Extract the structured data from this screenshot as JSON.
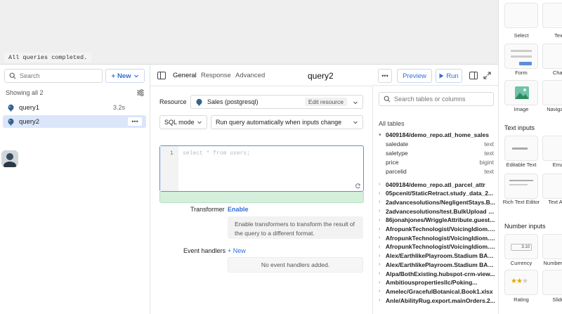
{
  "canvas": {
    "status": "All queries completed."
  },
  "query_list": {
    "search_placeholder": "Search",
    "new_label": "New",
    "showing": "Showing all 2",
    "queries": [
      {
        "name": "query1",
        "time": "3.2s"
      },
      {
        "name": "query2",
        "time": ""
      }
    ]
  },
  "editor": {
    "tabs": [
      "General",
      "Response",
      "Advanced"
    ],
    "query_name": "query2",
    "preview_label": "Preview",
    "run_label": "Run",
    "resource_label": "Resource",
    "resource_value": "Sales (postgresql)",
    "edit_resource": "Edit resource",
    "mode_value": "SQL mode",
    "trigger_value": "Run query automatically when inputs change",
    "line_number": "1",
    "code_placeholder": "select * from users;",
    "transformer_label": "Transformer",
    "transformer_enable": "Enable",
    "transformer_help": "Enable transformers to transform the result of the query to a different format.",
    "event_handlers_label": "Event handlers",
    "event_new": "+ New",
    "no_event_handlers": "No event handlers added."
  },
  "schema": {
    "search_placeholder": "Search tables or columns",
    "all_tables": "All tables",
    "expanded_table": "0409184/demo_repo.atl_home_sales",
    "columns": [
      {
        "name": "saledate",
        "type": "text"
      },
      {
        "name": "saletype",
        "type": "text"
      },
      {
        "name": "price",
        "type": "bigint"
      },
      {
        "name": "parcelid",
        "type": "text"
      }
    ],
    "tables": [
      "0409184/demo_repo.atl_parcel_attr",
      "05pcenit/StaticRetract.study_data_2...",
      "2advancesolutions/NegligentStays.B...",
      "2advancesolutions/test.BulkUpload (5)",
      "86jonahjones/WriggleAttribute.guest...",
      "AfropunkTechnologist/VoicingIdiom.c...",
      "AfropunkTechnologist/VoicingIdiom.c...",
      "AfropunkTechnologist/VoicingIdiom.c...",
      "Alex/EarthlikePlayroom.Stadium BAC...",
      "Alex/EarthlikePlayroom.Stadium BAC...",
      "Alpa/BothExisting.hubspot-crm-view...",
      "Ambitiouspropertiesllc/Poking...",
      "Amelec/GracefulBotanical.Book1.xlsx",
      "Anle/AbilityRug.export.mainOrders.2..."
    ]
  },
  "components": {
    "top_labels": [
      "Select",
      "Text"
    ],
    "mid_labels": [
      "Form",
      "Chart"
    ],
    "img_labels": [
      "Image",
      "Navigation"
    ],
    "text_inputs_heading": "Text inputs",
    "ti_row1": [
      "Editable Text",
      "Email"
    ],
    "ti_row2": [
      "Rich Text Editor",
      "Text Area"
    ],
    "number_inputs_heading": "Number inputs",
    "ni_row1": [
      "Currency",
      "Number input"
    ],
    "ni_row2": [
      "Rating",
      "Slider"
    ],
    "currency_sample": "3.10",
    "accent": "#2e6fd8"
  }
}
